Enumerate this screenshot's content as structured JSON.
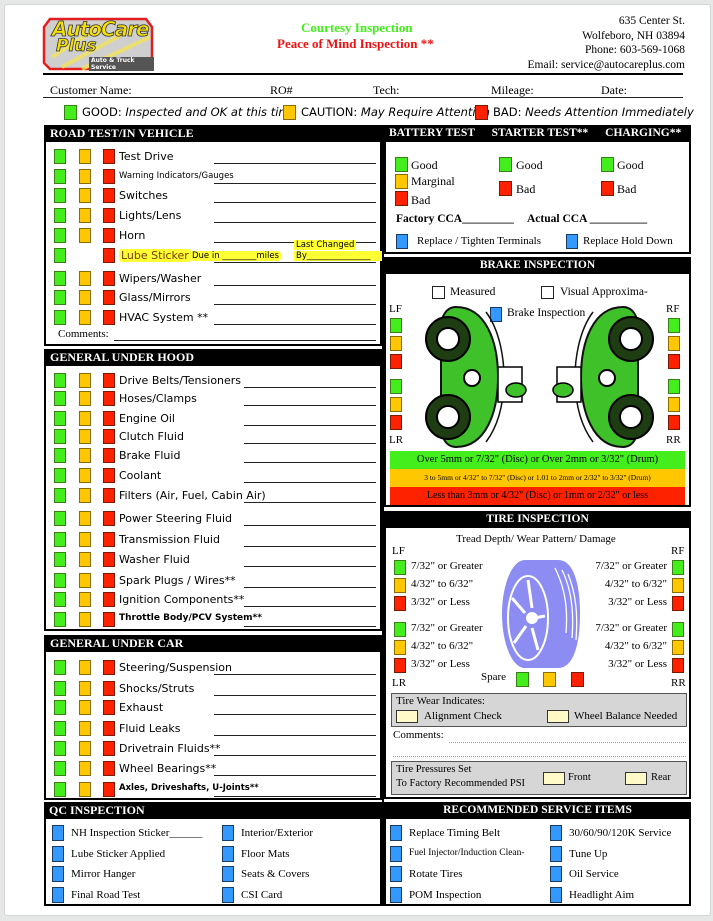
{
  "header": {
    "logo": {
      "line1": "AutoCare",
      "line2": "Plus",
      "tagline": "Auto & Truck Service"
    },
    "title": "Courtesy Inspection",
    "subtitle": "Peace of Mind Inspection **",
    "address": [
      "635 Center St.",
      "Wolfeboro, NH 03894",
      "Phone: 603-569-1068",
      "Email: service@autocareplus.com"
    ]
  },
  "fields": {
    "customer": "Customer Name:",
    "ro": "RO#",
    "tech": "Tech:",
    "mileage": "Mileage:",
    "date": "Date:"
  },
  "legend": {
    "good_label": "GOOD:",
    "good_desc": "Inspected and OK at this time",
    "caution_label": "CAUTION:",
    "caution_desc": "May Require Attention",
    "bad_label": "BAD:",
    "bad_desc": "Needs Attention Immediately"
  },
  "colors": {
    "good": "#44ee1c",
    "caution": "#ffc700",
    "bad": "#ff2200",
    "blue": "#3399ff"
  },
  "road_test": {
    "title": "ROAD TEST/IN VEHICLE",
    "items": [
      "Test Drive",
      "Warning Indicators/Gauges",
      "Switches",
      "Lights/Lens",
      "Horn",
      "Lube Sticker",
      "Wipers/Washer",
      "Glass/Mirrors",
      "HVAC System **"
    ],
    "lube_due": "Due in ________miles",
    "lube_last": "Last Changed",
    "lube_by": "By_______________",
    "comments": "Comments:"
  },
  "under_hood": {
    "title": "GENERAL UNDER HOOD",
    "items": [
      "Drive Belts/Tensioners",
      "Hoses/Clamps",
      "Engine Oil",
      "Clutch Fluid",
      "Brake Fluid",
      "Coolant",
      "Filters (Air, Fuel, Cabin Air)",
      "Power Steering Fluid",
      "Transmission Fluid",
      "Washer Fluid",
      "Spark Plugs / Wires**",
      "Ignition Components**",
      "Throttle Body/PCV System**"
    ]
  },
  "under_car": {
    "title": "GENERAL UNDER CAR",
    "items": [
      "Steering/Suspension",
      "Shocks/Struts",
      "Exhaust",
      "Fluid Leaks",
      "Drivetrain Fluids**",
      "Wheel Bearings**",
      "Axles, Driveshafts, U-Joints**"
    ]
  },
  "qc": {
    "title": "QC INSPECTION",
    "left": [
      "NH Inspection Sticker______",
      "Lube Sticker Applied",
      "Mirror Hanger",
      "Final Road Test"
    ],
    "right": [
      "Interior/Exterior",
      "Floor Mats",
      "Seats & Covers",
      "CSI Card"
    ]
  },
  "battery": {
    "titles": [
      "BATTERY TEST",
      "STARTER TEST**",
      "CHARGING**"
    ],
    "good": "Good",
    "marginal": "Marginal",
    "bad": "Bad",
    "factory_cca": "Factory CCA_________",
    "actual_cca": "Actual CCA __________",
    "replace_terminals": "Replace / Tighten Terminals",
    "replace_hold": "Replace Hold Down"
  },
  "brake": {
    "title": "BRAKE INSPECTION",
    "measured": "Measured",
    "visual": "Visual Approxima-",
    "brake_insp": "Brake Inspection",
    "lf": "LF",
    "rf": "RF",
    "lr": "LR",
    "rr": "RR",
    "scale_good": "Over 5mm or 7/32\" (Disc) or Over 2mm or 3/32\" (Drum)",
    "scale_caution": "3 to 5mm or 4/32\" to 7/32\" (Disc) or 1.01 to 2mm or 2/32\" to 3/32\" (Drum)",
    "scale_bad": "Less than 3mm or 4/32\" (Disc) or 1mm or 2/32\" or less"
  },
  "tire": {
    "title": "TIRE INSPECTION",
    "subtitle": "Tread Depth/ Wear Pattern/ Damage",
    "lf": "LF",
    "rf": "RF",
    "lr": "LR",
    "rr": "RR",
    "depths": [
      "7/32\" or Greater",
      "4/32\" to 6/32\"",
      "3/32\" or Less"
    ],
    "spare": "Spare",
    "wear_title": "Tire Wear Indicates:",
    "alignment": "Alignment Check",
    "balance": "Wheel Balance Needed",
    "comments": "Comments:",
    "pressure_line1": "Tire Pressures Set",
    "pressure_line2": "To Factory Recommended PSI",
    "front": "Front",
    "rear": "Rear"
  },
  "recommended": {
    "title": "RECOMMENDED SERVICE ITEMS",
    "left": [
      "Replace Timing Belt",
      "Fuel Injector/Induction Clean-",
      "Rotate Tires",
      "POM Inspection"
    ],
    "right": [
      "30/60/90/120K Service",
      "Tune Up",
      "Oil Service",
      "Headlight Aim"
    ]
  }
}
